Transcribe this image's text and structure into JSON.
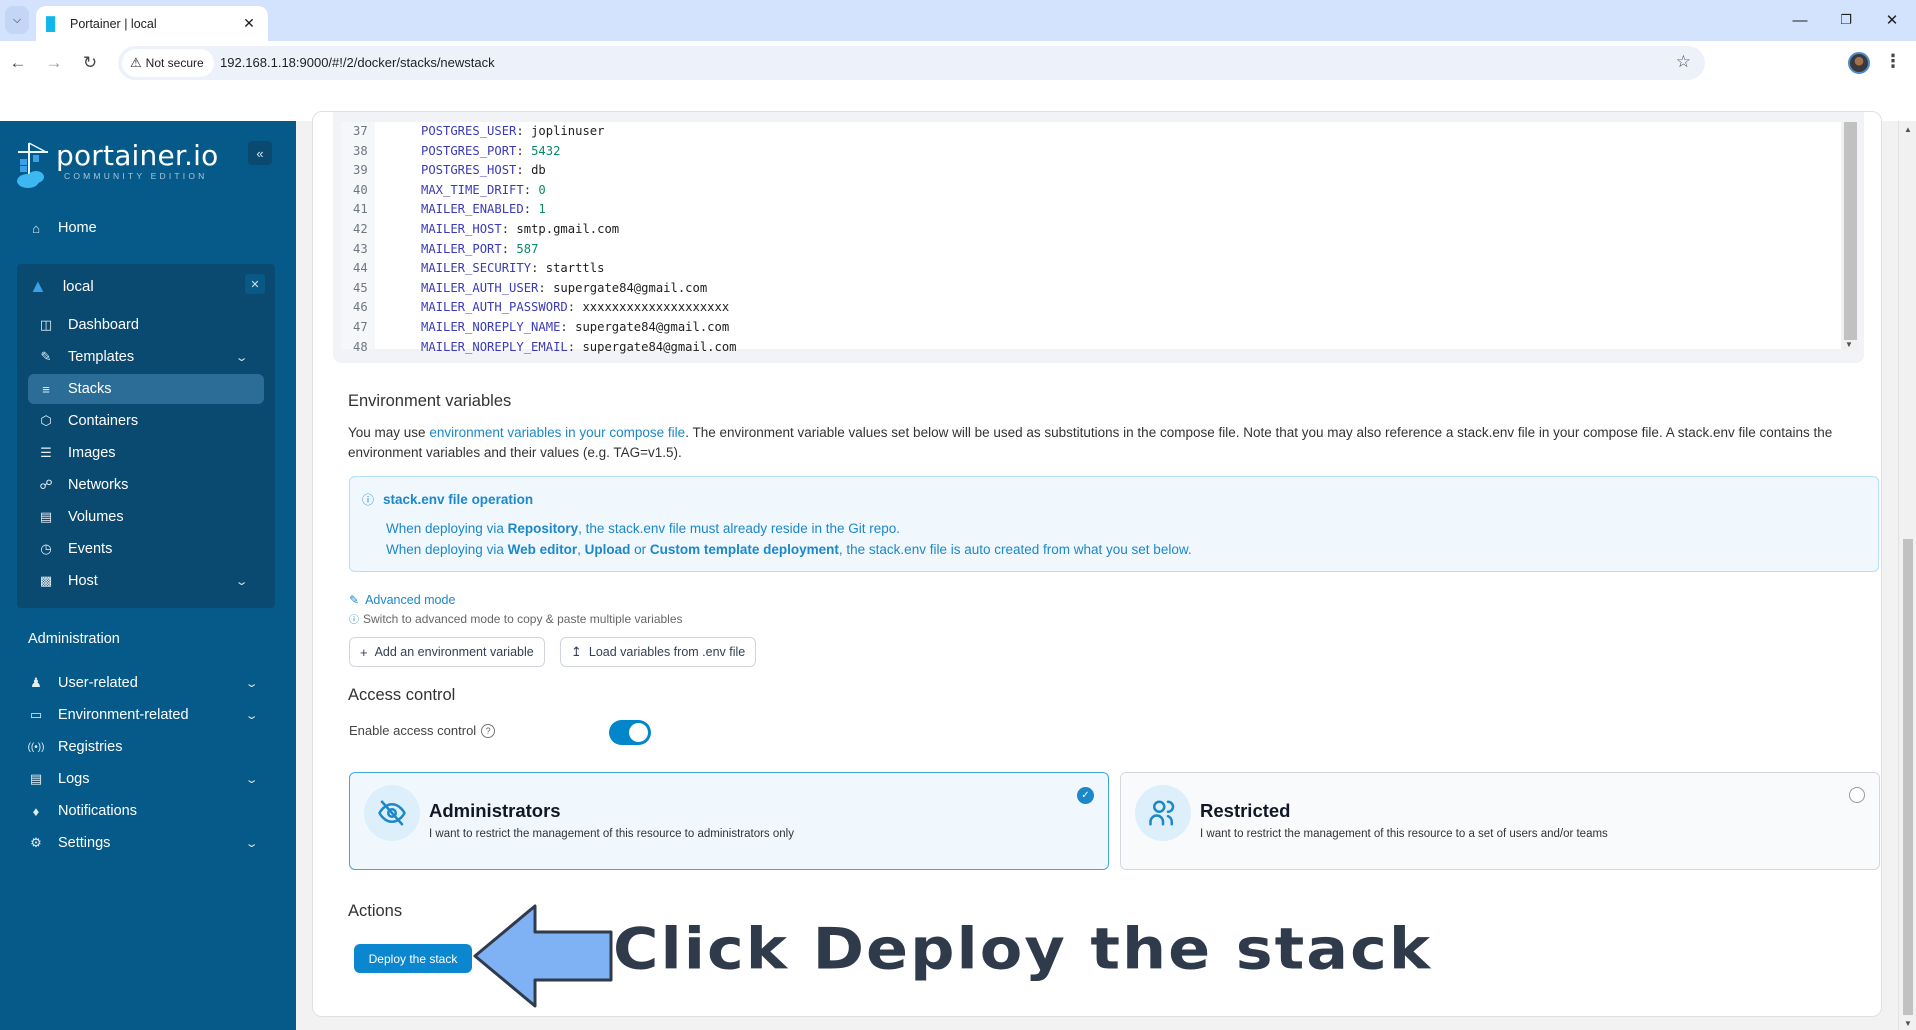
{
  "browser": {
    "tab_title": "Portainer | local",
    "security_label": "Not secure",
    "url": "192.168.1.18:9000/#!/2/docker/stacks/newstack"
  },
  "sidebar": {
    "logo_name": "portainer.io",
    "logo_edition": "COMMUNITY EDITION",
    "home": "Home",
    "environment": {
      "name": "local",
      "items": [
        {
          "label": "Dashboard",
          "icon": "dashboard-icon",
          "expandable": false,
          "active": false
        },
        {
          "label": "Templates",
          "icon": "edit-icon",
          "expandable": true,
          "active": false
        },
        {
          "label": "Stacks",
          "icon": "layers-icon",
          "expandable": false,
          "active": true
        },
        {
          "label": "Containers",
          "icon": "box-icon",
          "expandable": false,
          "active": false
        },
        {
          "label": "Images",
          "icon": "list-icon",
          "expandable": false,
          "active": false
        },
        {
          "label": "Networks",
          "icon": "network-icon",
          "expandable": false,
          "active": false
        },
        {
          "label": "Volumes",
          "icon": "database-icon",
          "expandable": false,
          "active": false
        },
        {
          "label": "Events",
          "icon": "clock-icon",
          "expandable": false,
          "active": false
        },
        {
          "label": "Host",
          "icon": "host-icon",
          "expandable": true,
          "active": false
        }
      ]
    },
    "admin_title": "Administration",
    "admin_items": [
      {
        "label": "User-related",
        "icon": "users-icon",
        "expandable": true
      },
      {
        "label": "Environment-related",
        "icon": "drive-icon",
        "expandable": true
      },
      {
        "label": "Registries",
        "icon": "radio-icon",
        "expandable": false
      },
      {
        "label": "Logs",
        "icon": "file-icon",
        "expandable": true
      },
      {
        "label": "Notifications",
        "icon": "bell-icon",
        "expandable": false
      },
      {
        "label": "Settings",
        "icon": "gear-icon",
        "expandable": true
      }
    ]
  },
  "editor": {
    "lines": [
      {
        "n": "37",
        "key": "POSTGRES_USER",
        "value": "joplinuser",
        "type": "str"
      },
      {
        "n": "38",
        "key": "POSTGRES_PORT",
        "value": "5432",
        "type": "num"
      },
      {
        "n": "39",
        "key": "POSTGRES_HOST",
        "value": "db",
        "type": "str"
      },
      {
        "n": "40",
        "key": "MAX_TIME_DRIFT",
        "value": "0",
        "type": "num"
      },
      {
        "n": "41",
        "key": "MAILER_ENABLED",
        "value": "1",
        "type": "num"
      },
      {
        "n": "42",
        "key": "MAILER_HOST",
        "value": "smtp.gmail.com",
        "type": "str"
      },
      {
        "n": "43",
        "key": "MAILER_PORT",
        "value": "587",
        "type": "num"
      },
      {
        "n": "44",
        "key": "MAILER_SECURITY",
        "value": "starttls",
        "type": "str"
      },
      {
        "n": "45",
        "key": "MAILER_AUTH_USER",
        "value": "supergate84@gmail.com",
        "type": "str"
      },
      {
        "n": "46",
        "key": "MAILER_AUTH_PASSWORD",
        "value": "xxxxxxxxxxxxxxxxxxxx",
        "type": "str"
      },
      {
        "n": "47",
        "key": "MAILER_NOREPLY_NAME",
        "value": "supergate84@gmail.com",
        "type": "str"
      },
      {
        "n": "48",
        "key": "MAILER_NOREPLY_EMAIL",
        "value": "supergate84@gmail.com",
        "type": "str"
      }
    ]
  },
  "env_vars": {
    "title": "Environment variables",
    "desc_prefix": "You may use ",
    "desc_link": "environment variables in your compose file",
    "desc_suffix": ". The environment variable values set below will be used as substitutions in the compose file. Note that you may also reference a stack.env file in your compose file. A stack.env file contains the environment variables and their values (e.g. TAG=v1.5).",
    "info_title": "stack.env file operation",
    "info_line1": {
      "a": "When deploying via ",
      "b": "Repository",
      "c": ", the stack.env file must already reside in the Git repo."
    },
    "info_line2": {
      "a": "When deploying via ",
      "b": "Web editor",
      "c": ", ",
      "d": "Upload",
      "e": " or ",
      "f": "Custom template deployment",
      "g": ", the stack.env file is auto created from what you set below."
    },
    "advanced_mode": "Advanced mode",
    "advanced_hint": "Switch to advanced mode to copy & paste multiple variables",
    "add_button": "Add an environment variable",
    "load_button": "Load variables from .env file"
  },
  "access_control": {
    "title": "Access control",
    "toggle_label": "Enable access control",
    "enabled": true,
    "options": [
      {
        "title": "Administrators",
        "desc": "I want to restrict the management of this resource to administrators only",
        "selected": true
      },
      {
        "title": "Restricted",
        "desc": "I want to restrict the management of this resource to a set of users and/or teams",
        "selected": false
      }
    ]
  },
  "actions": {
    "title": "Actions",
    "deploy_button": "Deploy the stack"
  },
  "annotation": {
    "text": "Click Deploy the stack",
    "arrow_color": "#7fb1f5"
  },
  "colors": {
    "sidebar_bg": "#055a8a",
    "accent": "#1c87c9",
    "primary_button": "#0a87ce"
  }
}
